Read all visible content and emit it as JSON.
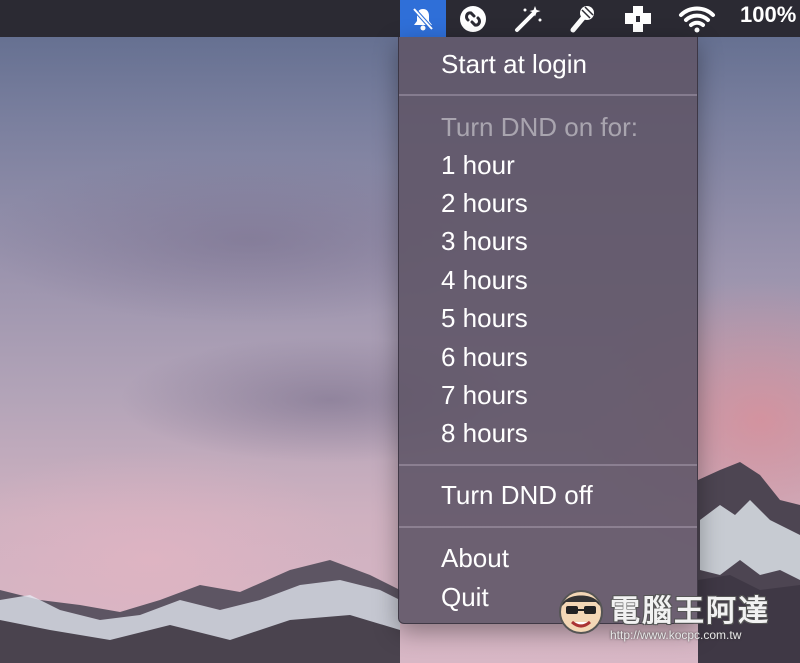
{
  "menubar": {
    "status_icons": [
      {
        "name": "dnd-bell-slash-icon",
        "active": true
      },
      {
        "name": "shazam-icon",
        "active": false
      },
      {
        "name": "magic-wand-icon",
        "active": false
      },
      {
        "name": "microphone-icon",
        "active": false
      },
      {
        "name": "medical-cross-icon",
        "active": false
      },
      {
        "name": "wifi-icon",
        "active": false
      }
    ],
    "battery_text": "100%",
    "active_color": "#2f6fd8"
  },
  "menu": {
    "start_at_login": "Start at login",
    "dnd_heading": "Turn DND on for:",
    "hours": [
      "1 hour",
      "2 hours",
      "3 hours",
      "4 hours",
      "5 hours",
      "6 hours",
      "7 hours",
      "8 hours"
    ],
    "turn_dnd_off": "Turn DND off",
    "about": "About",
    "quit": "Quit"
  },
  "watermark": {
    "title": "電腦王阿達",
    "url": "http://www.kocpc.com.tw"
  }
}
